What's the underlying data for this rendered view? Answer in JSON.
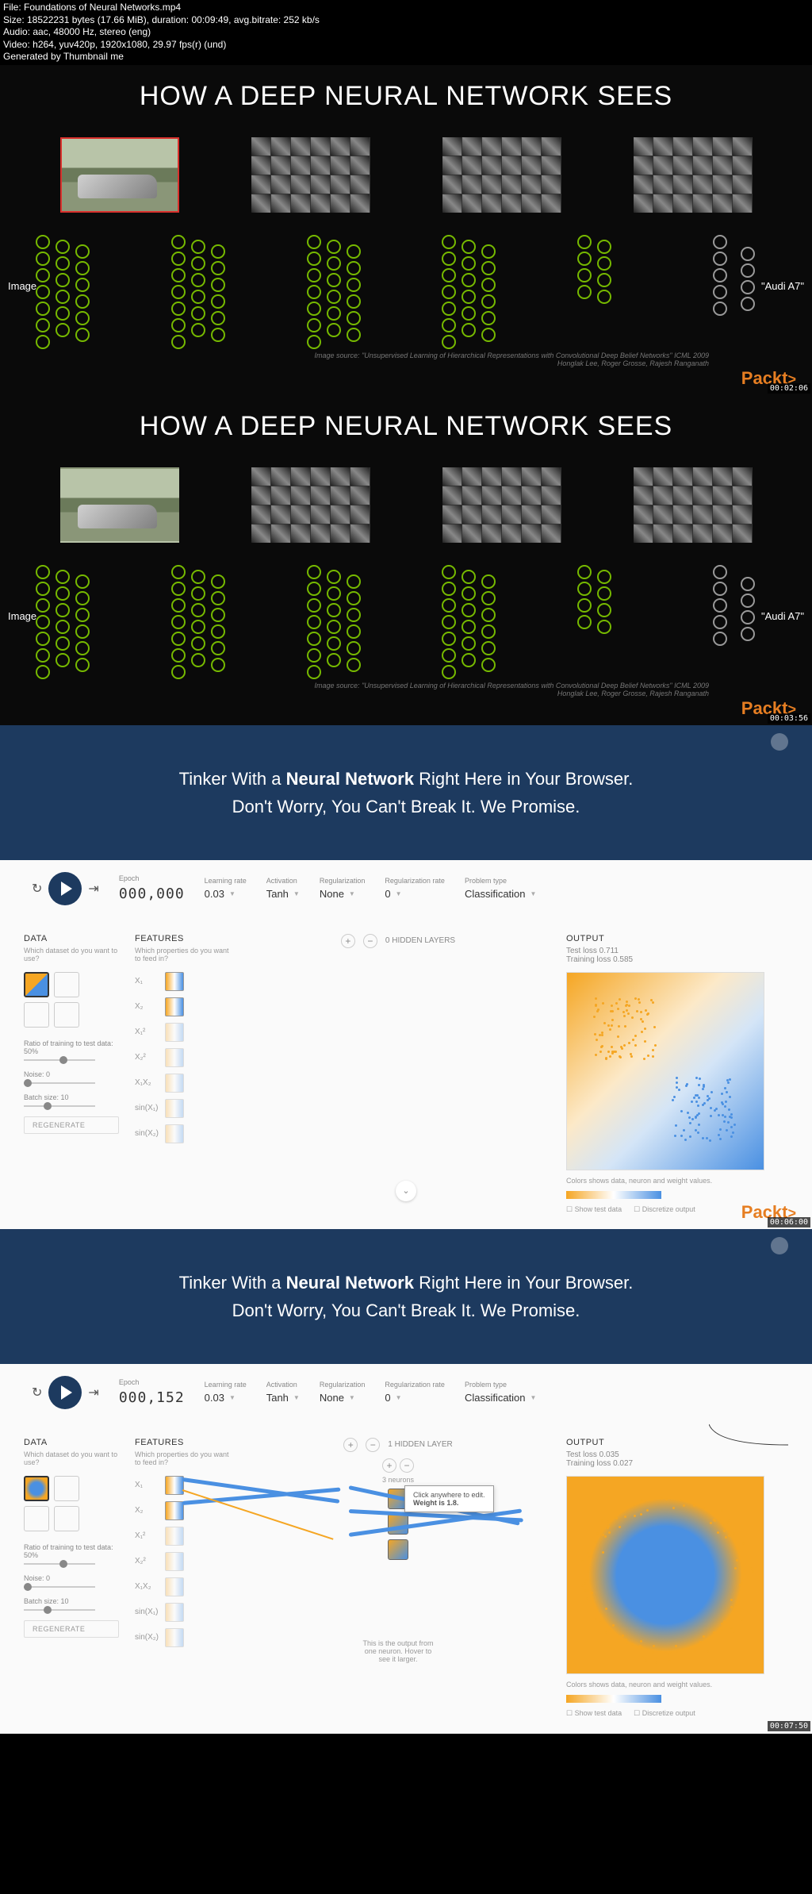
{
  "meta": {
    "file": "File: Foundations of Neural Networks.mp4",
    "size": "Size: 18522231 bytes (17.66 MiB), duration: 00:09:49, avg.bitrate: 252 kb/s",
    "audio": "Audio: aac, 48000 Hz, stereo (eng)",
    "video": "Video: h264, yuv420p, 1920x1080, 29.97 fps(r) (und)",
    "generated": "Generated by Thumbnail me"
  },
  "nvidia": {
    "title": "HOW A DEEP NEURAL NETWORK SEES",
    "label_image": "Image",
    "label_output": "\"Audi A7\"",
    "citation1": "Image source: \"Unsupervised Learning of Hierarchical Representations with Convolutional Deep Belief Networks\" ICML 2009",
    "citation2": "Honglak Lee, Roger Grosse, Rajesh Ranganath"
  },
  "logo": "Packt",
  "timestamps": {
    "f1": "00:02:06",
    "f2": "00:03:56",
    "f3": "00:06:00",
    "f4": "00:07:50"
  },
  "tensorflow": {
    "header1": "Tinker With a ",
    "header1b": "Neural Network",
    "header1c": " Right Here in Your Browser.",
    "header2": "Don't Worry, You Can't Break It. We Promise.",
    "controls": {
      "epoch_label": "Epoch",
      "epoch_f3": "000,000",
      "epoch_f4": "000,152",
      "lr_label": "Learning rate",
      "lr_val": "0.03",
      "act_label": "Activation",
      "act_val": "Tanh",
      "reg_label": "Regularization",
      "reg_val": "None",
      "regrate_label": "Regularization rate",
      "regrate_val": "0",
      "prob_label": "Problem type",
      "prob_val": "Classification"
    },
    "data": {
      "title": "DATA",
      "sub": "Which dataset do you want to use?",
      "ratio_label": "Ratio of training to test data:  50%",
      "noise_label": "Noise:  0",
      "batch_label": "Batch size:  10",
      "regen": "REGENERATE"
    },
    "features": {
      "title": "FEATURES",
      "sub": "Which properties do you want to feed in?",
      "x1": "X₁",
      "x2": "X₂",
      "x1sq": "X₁²",
      "x2sq": "X₂²",
      "x1x2": "X₁X₂",
      "sinx1": "sin(X₁)",
      "sinx2": "sin(X₂)"
    },
    "hidden": {
      "count_f3": "0  HIDDEN LAYERS",
      "count_f4": "1  HIDDEN LAYER",
      "neurons": "3 neurons",
      "tip_f4": "Click anywhere to edit.",
      "tip_weight": "Weight is 1.8.",
      "tip_output": "This is the output from one neuron. Hover to see it larger."
    },
    "output": {
      "title": "OUTPUT",
      "test_f3": "Test loss 0.711",
      "train_f3": "Training loss 0.585",
      "test_f4": "Test loss 0.035",
      "train_f4": "Training loss 0.027",
      "legend": "Colors shows data, neuron and weight values.",
      "cb1": "Show test data",
      "cb2": "Discretize output"
    }
  }
}
